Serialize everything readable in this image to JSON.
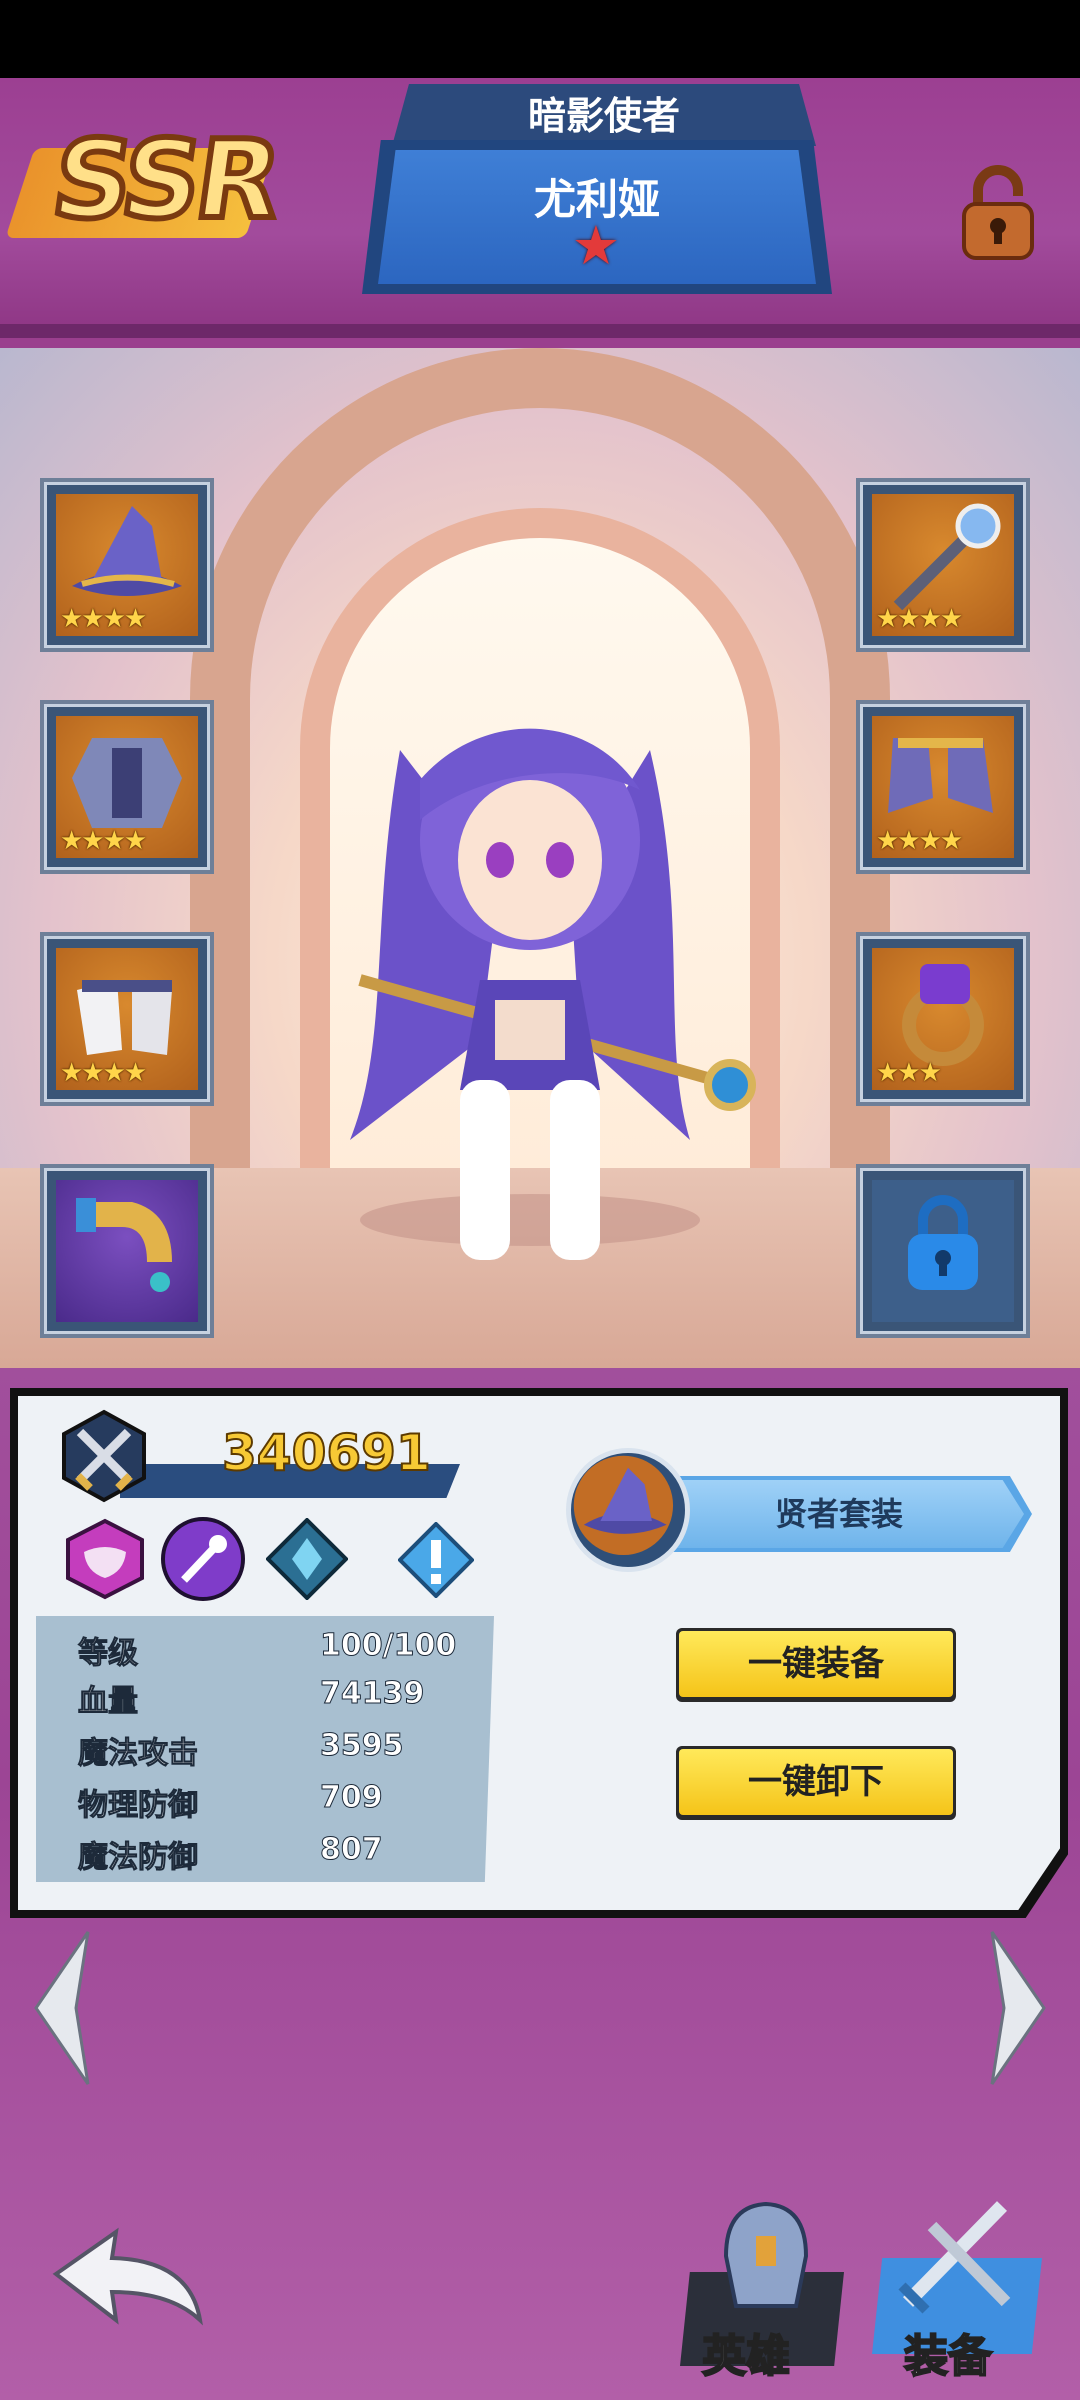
{
  "header": {
    "rarity": "SSR",
    "title": "暗影使者",
    "hero_name": "尤利娅",
    "star": "★"
  },
  "equipment": {
    "left": [
      {
        "name": "wizard-hat-icon",
        "stars": "★★★★"
      },
      {
        "name": "armor-icon",
        "stars": "★★★★"
      },
      {
        "name": "gloves-icon",
        "stars": "★★★★"
      },
      {
        "name": "horn-icon",
        "stars": ""
      }
    ],
    "right": [
      {
        "name": "staff-icon",
        "stars": "★★★★"
      },
      {
        "name": "boots-icon",
        "stars": "★★★★"
      },
      {
        "name": "ring-icon",
        "stars": "★★★"
      },
      {
        "name": "lock-icon",
        "stars": ""
      }
    ]
  },
  "info": {
    "power": "340691",
    "set_name": "贤者套装",
    "equip_all": "一键装备",
    "unequip_all": "一键卸下",
    "stats": [
      {
        "label": "等级",
        "value": "100/100"
      },
      {
        "label": "血量",
        "value": "74139"
      },
      {
        "label": "魔法攻击",
        "value": "3595"
      },
      {
        "label": "物理防御",
        "value": "709"
      },
      {
        "label": "魔法防御",
        "value": "807"
      }
    ]
  },
  "nav": {
    "hero": "英雄",
    "equipment": "装备"
  },
  "colors": {
    "accent": "#f5c419",
    "panel_blue": "#2c66c0",
    "bg_purple": "#9c4595"
  }
}
